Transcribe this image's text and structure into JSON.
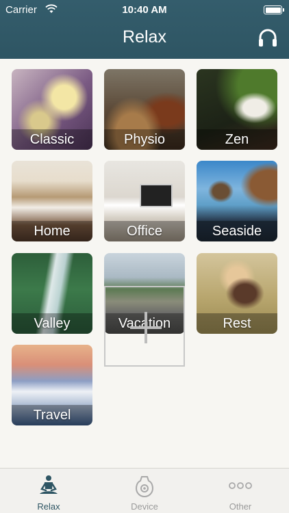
{
  "status_bar": {
    "carrier": "Carrier",
    "time": "10:40 AM"
  },
  "nav": {
    "title": "Relax",
    "right_icon": "headphones-icon"
  },
  "tiles": [
    {
      "label": "Classic"
    },
    {
      "label": "Physio"
    },
    {
      "label": "Zen"
    },
    {
      "label": "Home"
    },
    {
      "label": "Office"
    },
    {
      "label": "Seaside"
    },
    {
      "label": "Valley"
    },
    {
      "label": "Vacation"
    },
    {
      "label": "Rest"
    },
    {
      "label": "Travel"
    }
  ],
  "add_tile": {
    "icon": "plus-icon"
  },
  "tabbar": {
    "tabs": [
      {
        "label": "Relax",
        "icon": "meditation-icon",
        "active": true
      },
      {
        "label": "Device",
        "icon": "device-icon",
        "active": false
      },
      {
        "label": "Other",
        "icon": "more-icon",
        "active": false
      }
    ]
  },
  "colors": {
    "header": "#2e5563",
    "background": "#f7f6f2",
    "active_tab": "#2e5563",
    "inactive_tab": "#9a9a9a"
  }
}
